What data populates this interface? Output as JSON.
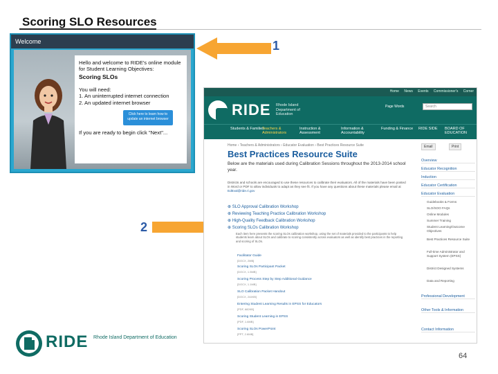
{
  "slide": {
    "title": "Scoring SLO Resources",
    "page_number": "64"
  },
  "callouts": {
    "one": "1",
    "two": "2"
  },
  "welcome": {
    "window_title": "Welcome",
    "intro": "Hello and welcome to RIDE's online module for Student Learning Objectives:",
    "heading": "Scoring SLOs",
    "need": "You will need:",
    "req1": "1. An uninterrupted internet connection",
    "req2": "2. An updated internet browser",
    "button": "Click here to learn how to update an internet browser",
    "next": "If you are ready to begin click \"Next\"..."
  },
  "site": {
    "topnav": "Home News Events Commissioner's Corner",
    "logo": "RIDE",
    "logo_sub": "Rhode Island Department of Education",
    "search_label": "Page Words",
    "search_placeholder": "Search",
    "subnav": [
      "Students & Families",
      "Teachers & Administrators",
      "Instruction & Assessment",
      "Information & Accountability",
      "Funding & Finance",
      "RIDE SIDE",
      "BOARD OF EDUCATION"
    ],
    "breadcrumb": "Home › Teachers & Administrators › Educator Evaluation › Best Practices Resource Suite",
    "heading": "Best Practices Resource Suite",
    "lead": "Below are the materials used during Calibration Sessions throughout the 2013-2014 school year.",
    "note": "Districts and schools are encouraged to use these resources to calibrate their evaluators. All of the materials have been posted in Word or PDF to allow individuals to adapt as they see fit. If you have any questions about these materials please email at",
    "email": "EdEval@ride.ri.gov",
    "workshops": [
      "SLO Approval Calibration Workshop",
      "Reviewing Teaching Practice Calibration Workshop",
      "High-Quality Feedback Calibration Workshop",
      "Scoring SLOs Calibration Workshop"
    ],
    "workshop_desc": "Each item here presents the scoring SLOs calibration workshop, using the set of materials provided to the participants to help students learn about SLOs and calibrate to scoring consistently across evaluators as well as identify best practices in the reporting and scoring of SLOs.",
    "resources": [
      {
        "name": "Facilitator Guide",
        "meta": "[DOCX, 2MB]"
      },
      {
        "name": "Scoring SLOs Participant Packet",
        "meta": "[DOCX, 1.5MB]"
      },
      {
        "name": "Scoring Process Step by Step Additional Guidance",
        "meta": "[DOCX, 1.1MB]"
      },
      {
        "name": "SLO Calibration Packet Handout",
        "meta": "[DOCX, 244KB]"
      },
      {
        "name": "Entering Student Learning Results in EPSS for Educators",
        "meta": "[PDF, 682KB]"
      },
      {
        "name": "Scoring Student Learning in EPSS",
        "meta": "[PDF, 1.6MB]"
      },
      {
        "name": "Scoring SLOs PowerPoint",
        "meta": "[PPT, 2.6MB]"
      }
    ],
    "sidebar_buttons": [
      "Email",
      "Print"
    ],
    "sidebar_items": [
      "Overview",
      "Educator Recognition",
      "Induction",
      "Educator Certification",
      "Educator Evaluation"
    ],
    "sidebar_subitems": [
      "Guidebooks & Forms",
      "SLO/SOO FAQs",
      "Online Modules",
      "Summer Training",
      "Student Learning/Outcome Objectives",
      "Best Practices Resource Suite",
      "Full-time Administrator and Support System (EPSS)",
      "District Designed Systems",
      "Data and Reporting"
    ],
    "sidebar_items_bottom": [
      "Professional Development",
      "Other Tools & Information",
      "Contact Information"
    ]
  },
  "footer": {
    "logo": "RIDE",
    "logo_sub": "Rhode Island Department of Education"
  }
}
